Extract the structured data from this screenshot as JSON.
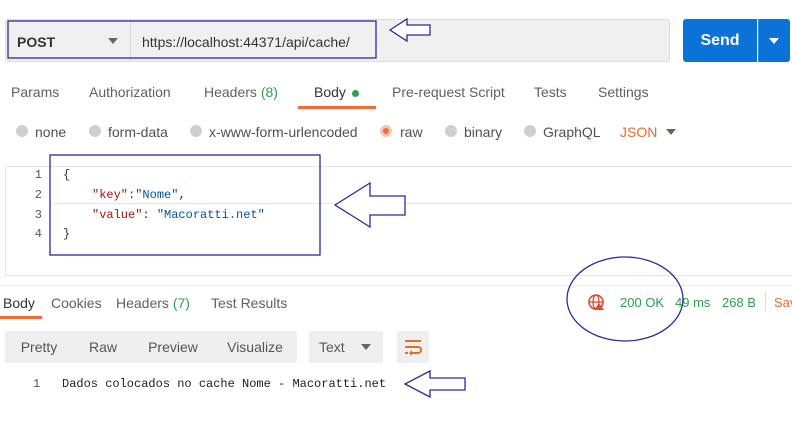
{
  "request": {
    "method": "POST",
    "url": "https://localhost:44371/api/cache/",
    "send_label": "Send"
  },
  "tabs": [
    {
      "label": "Params"
    },
    {
      "label": "Authorization"
    },
    {
      "label": "Headers",
      "count": "(8)"
    },
    {
      "label": "Body"
    },
    {
      "label": "Pre-request Script"
    },
    {
      "label": "Tests"
    },
    {
      "label": "Settings"
    }
  ],
  "body_types": [
    {
      "label": "none"
    },
    {
      "label": "form-data"
    },
    {
      "label": "x-www-form-urlencoded"
    },
    {
      "label": "raw",
      "selected": true
    },
    {
      "label": "binary"
    },
    {
      "label": "GraphQL"
    }
  ],
  "format": "JSON",
  "editor": {
    "line_numbers": [
      "1",
      "2",
      "3",
      "4"
    ],
    "open_brace": "{",
    "close_brace": "}",
    "key1": "\"key\"",
    "colon1": ":",
    "val1": "\"Nome\"",
    "comma1": ",",
    "key2": "\"value\"",
    "colon2": ": ",
    "val2": "\"Macoratti.net\""
  },
  "response": {
    "tabs": [
      {
        "label": "Body"
      },
      {
        "label": "Cookies"
      },
      {
        "label": "Headers",
        "count": "(7)"
      },
      {
        "label": "Test Results"
      }
    ],
    "status": "200 OK",
    "time": "49 ms",
    "size": "268 B",
    "save_label": "Sav",
    "view_buttons": [
      "Pretty",
      "Raw",
      "Preview",
      "Visualize"
    ],
    "text_format": "Text",
    "line_number": "1",
    "text": "Dados colocados no cache Nome - Macoratti.net"
  },
  "colors": {
    "accent": "#f26b3a",
    "send": "#0b72d7",
    "status_ok": "#2e9e4f",
    "annotation": "#2b2b9a"
  }
}
